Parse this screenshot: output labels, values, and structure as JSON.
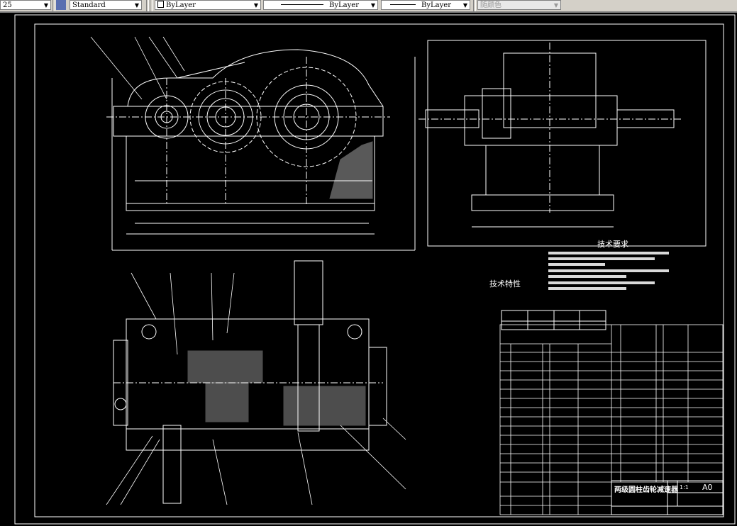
{
  "toolbar": {
    "text_height": "25",
    "text_style": "Standard",
    "layer_color": "ByLayer",
    "linetype": "ByLayer",
    "lineweight": "ByLayer",
    "plot_style": "随颜色"
  },
  "drawing": {
    "tech_requirements_title": "技术要求",
    "tech_characteristics_title": "技术特性",
    "title_block": {
      "drawing_name": "两级圆柱齿轮减速器",
      "scale": "1:1",
      "sheet_size": "A0"
    }
  },
  "colors": {
    "background": "#000000",
    "lines": "#ffffff",
    "toolbar": "#d4d0c8"
  }
}
